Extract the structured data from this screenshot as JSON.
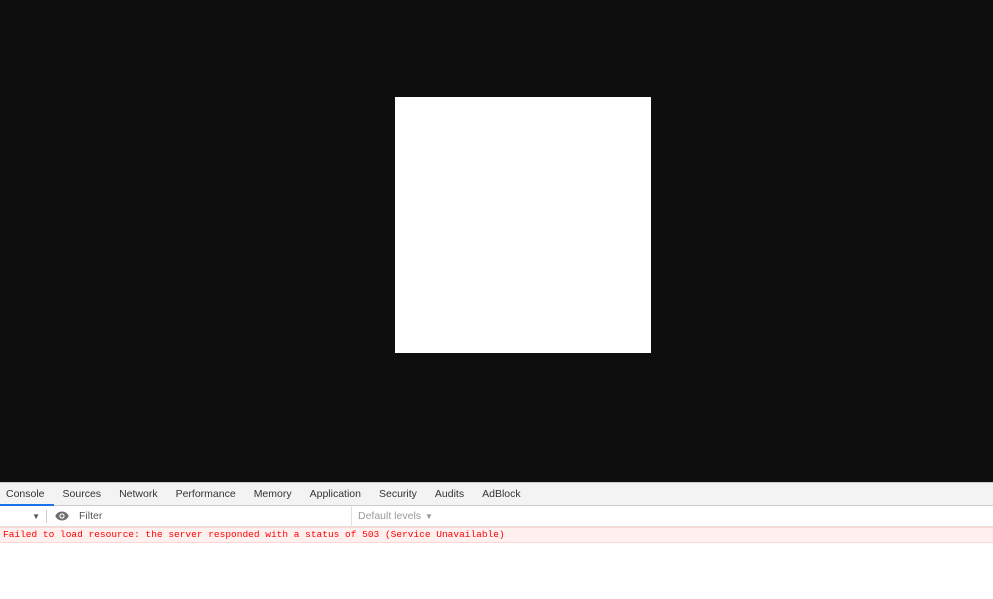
{
  "devtools": {
    "tabs": [
      {
        "label": "Console",
        "active": true
      },
      {
        "label": "Sources",
        "active": false
      },
      {
        "label": "Network",
        "active": false
      },
      {
        "label": "Performance",
        "active": false
      },
      {
        "label": "Memory",
        "active": false
      },
      {
        "label": "Application",
        "active": false
      },
      {
        "label": "Security",
        "active": false
      },
      {
        "label": "Audits",
        "active": false
      },
      {
        "label": "AdBlock",
        "active": false
      }
    ],
    "toolbar": {
      "context_arrow": "▼",
      "eye_icon": "eye-icon",
      "filter_placeholder": "Filter",
      "filter_value": "",
      "levels_label": "Default levels",
      "levels_arrow": "▼"
    },
    "messages": [
      {
        "level": "error",
        "text": "Failed to load resource: the server responded with a status of 503 (Service Unavailable)"
      }
    ],
    "colors": {
      "active_tab_underline": "#1a73e8",
      "error_text": "#ff0000",
      "error_background": "#fff0f0",
      "viewport_background": "#0e0e0e"
    }
  }
}
